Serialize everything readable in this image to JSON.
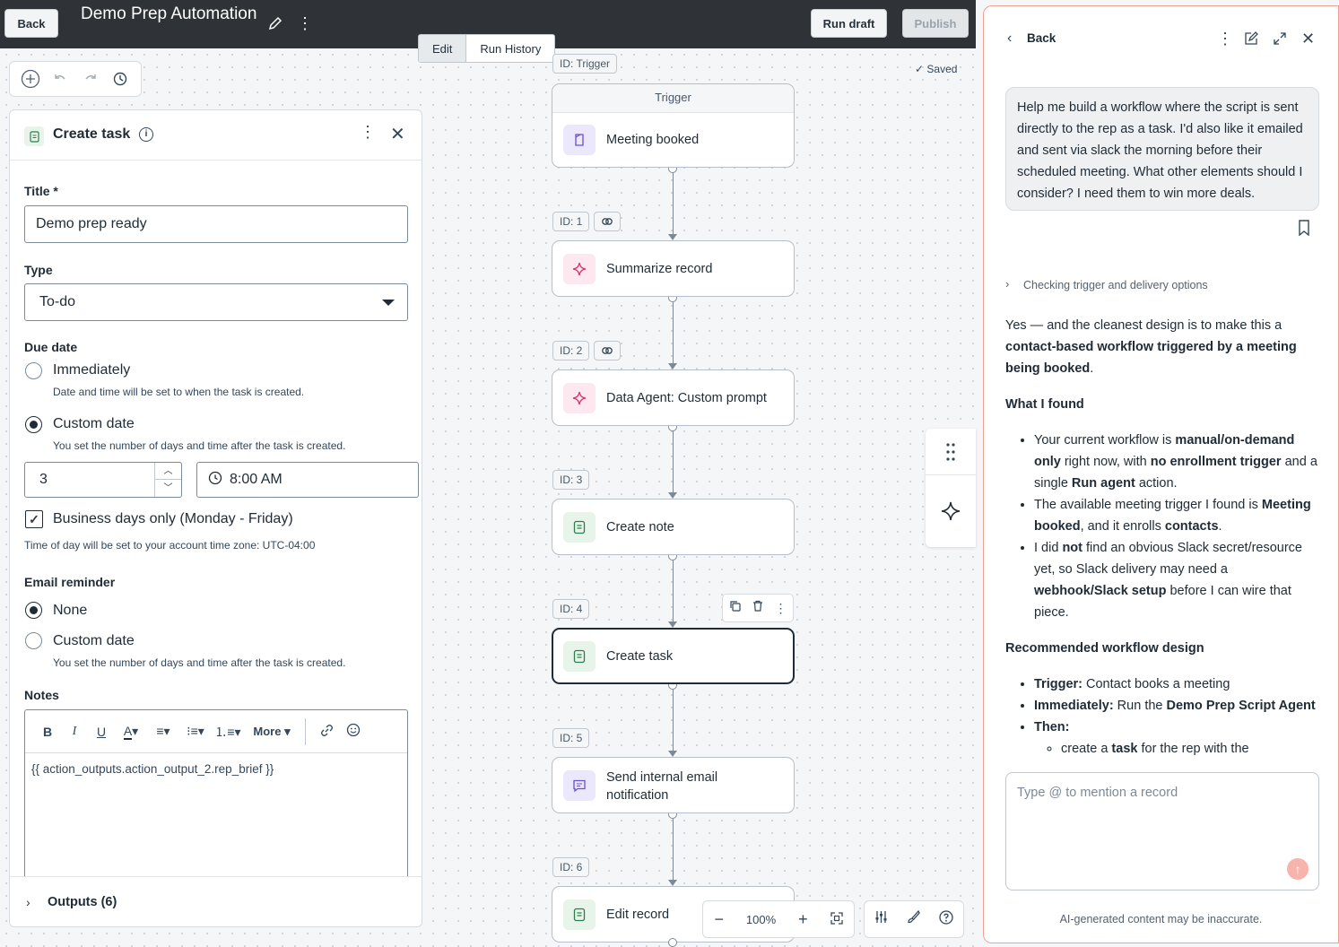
{
  "topbar": {
    "back_label": "Back",
    "title": "Demo Prep Automation",
    "run_draft_label": "Run draft",
    "publish_label": "Publish"
  },
  "canvas": {
    "tabs": [
      "Edit",
      "Run History"
    ],
    "saved_label": "Saved",
    "zoom": "100%"
  },
  "panel": {
    "title": "Create task",
    "title_label": "Title *",
    "title_value": "Demo prep ready",
    "type_label": "Type",
    "type_value": "To-do",
    "due_label": "Due date",
    "due_opt1": "Immediately",
    "due_opt1_hint": "Date and time will be set to when the task is created.",
    "due_opt2": "Custom date",
    "due_opt2_hint": "You set the number of days and time after the task is created.",
    "days_value": "3",
    "time_value": "8:00 AM",
    "business_days": "Business days only (Monday - Friday)",
    "tz_note": "Time of day will be set to your account time zone: UTC-04:00",
    "reminder_label": "Email reminder",
    "rem_opt1": "None",
    "rem_opt2": "Custom date",
    "rem_opt2_hint": "You set the number of days and time after the task is created.",
    "notes_label": "Notes",
    "more_label": "More",
    "notes_value": "{{ action_outputs.action_output_2.rep_brief }}",
    "outputs_label": "Outputs (6)"
  },
  "nodes": [
    {
      "id": "ID: Trigger",
      "header": "Trigger",
      "label": "Meeting booked"
    },
    {
      "id": "ID: 1",
      "label": "Summarize record"
    },
    {
      "id": "ID: 2",
      "label": "Data Agent: Custom prompt"
    },
    {
      "id": "ID: 3",
      "label": "Create note"
    },
    {
      "id": "ID: 4",
      "label": "Create task"
    },
    {
      "id": "ID: 5",
      "label": "Send internal email notification"
    },
    {
      "id": "ID: 6",
      "label": "Edit record"
    }
  ],
  "side": {
    "back_label": "Back",
    "user_msg": "Help me build a workflow where the script is sent directly to the rep as a task. I'd also like it emailed and sent via slack the morning before their scheduled meeting. What other elements should I consider? I need them to win more deals.",
    "thinking": "Checking trigger and delivery options",
    "input_placeholder": "Type @ to mention a record",
    "disclaimer": "AI-generated content may be inaccurate.",
    "resp": {
      "p1a": "Yes — and the cleanest design is to make this a ",
      "p1b": "contact-based workflow triggered by a meeting being booked",
      "p1c": ".",
      "h1": "What I found",
      "b1a": "Your current workflow is ",
      "b1b": "manual/on-demand only",
      "b1c": " right now, with ",
      "b1d": "no enrollment trigger",
      "b1e": " and a single ",
      "b1f": "Run agent",
      "b1g": " action.",
      "b2a": "The available meeting trigger I found is ",
      "b2b": "Meeting booked",
      "b2c": ", and it enrolls ",
      "b2d": "contacts",
      "b2e": ".",
      "b3a": "I did ",
      "b3b": "not",
      "b3c": " find an obvious Slack secret/resource yet, so Slack delivery may need a ",
      "b3d": "webhook/Slack setup",
      "b3e": " before I can wire that piece.",
      "h2": "Recommended workflow design",
      "r1a": "Trigger:",
      "r1b": " Contact books a meeting",
      "r2a": "Immediately:",
      "r2b": " Run the ",
      "r2c": "Demo Prep Script Agent",
      "r3a": "Then:",
      "r4a": "create a ",
      "r4b": "task",
      "r4c": " for the rep with the"
    }
  }
}
